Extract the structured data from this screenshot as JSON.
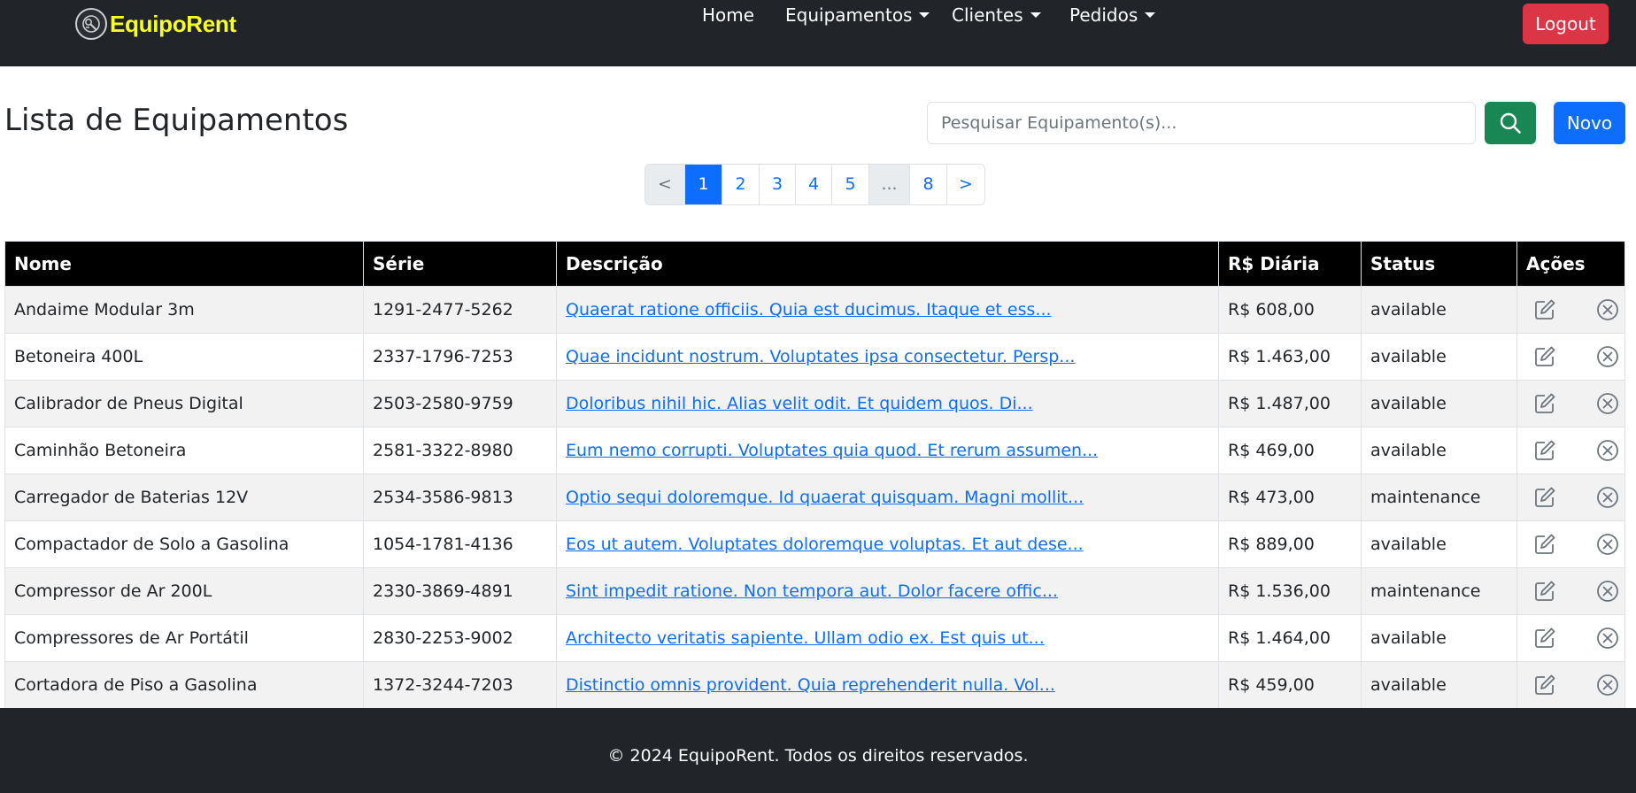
{
  "brand": {
    "name": "EquipoRent"
  },
  "nav": {
    "items": [
      {
        "label": "Home",
        "dropdown": false
      },
      {
        "label": "Equipamentos",
        "dropdown": true
      },
      {
        "label": "Clientes",
        "dropdown": true
      },
      {
        "label": "Pedidos",
        "dropdown": true
      }
    ],
    "logout_label": "Logout"
  },
  "page": {
    "title": "Lista de Equipamentos",
    "search_placeholder": "Pesquisar Equipamento(s)...",
    "search_icon": "search-icon",
    "new_label": "Novo"
  },
  "pagination": {
    "items": [
      "<",
      "1",
      "2",
      "3",
      "4",
      "5",
      "...",
      "8",
      ">"
    ],
    "active": "1"
  },
  "table": {
    "headers": [
      "Nome",
      "Série",
      "Descrição",
      "R$ Diária",
      "Status",
      "Ações"
    ],
    "rows": [
      {
        "nome": "Andaime Modular 3m",
        "serie": "1291-2477-5262",
        "descricao": "Quaerat ratione officiis. Quia est ducimus. Itaque et ess...",
        "diaria": "R$ 608,00",
        "status": "available"
      },
      {
        "nome": "Betoneira 400L",
        "serie": "2337-1796-7253",
        "descricao": "Quae incidunt nostrum. Voluptates ipsa consectetur. Persp...",
        "diaria": "R$ 1.463,00",
        "status": "available"
      },
      {
        "nome": "Calibrador de Pneus Digital",
        "serie": "2503-2580-9759",
        "descricao": "Doloribus nihil hic. Alias velit odit. Et quidem quos. Di...",
        "diaria": "R$ 1.487,00",
        "status": "available"
      },
      {
        "nome": "Caminhão Betoneira",
        "serie": "2581-3322-8980",
        "descricao": "Eum nemo corrupti. Voluptates quia quod. Et rerum assumen...",
        "diaria": "R$ 469,00",
        "status": "available"
      },
      {
        "nome": "Carregador de Baterias 12V",
        "serie": "2534-3586-9813",
        "descricao": "Optio sequi doloremque. Id quaerat quisquam. Magni mollit...",
        "diaria": "R$ 473,00",
        "status": "maintenance"
      },
      {
        "nome": "Compactador de Solo a Gasolina",
        "serie": "1054-1781-4136",
        "descricao": "Eos ut autem. Voluptates doloremque voluptas. Et aut dese...",
        "diaria": "R$ 889,00",
        "status": "available"
      },
      {
        "nome": "Compressor de Ar 200L",
        "serie": "2330-3869-4891",
        "descricao": "Sint impedit ratione. Non tempora aut. Dolor facere offic...",
        "diaria": "R$ 1.536,00",
        "status": "maintenance"
      },
      {
        "nome": "Compressores de Ar Portátil",
        "serie": "2830-2253-9002",
        "descricao": "Architecto veritatis sapiente. Ullam odio ex. Est quis ut...",
        "diaria": "R$ 1.464,00",
        "status": "available"
      },
      {
        "nome": "Cortadora de Piso a Gasolina",
        "serie": "1372-3244-7203",
        "descricao": "Distinctio omnis provident. Quia reprehenderit nulla. Vol...",
        "diaria": "R$ 459,00",
        "status": "available"
      }
    ],
    "row_action_icons": [
      "edit-icon",
      "delete-icon"
    ]
  },
  "footer": {
    "text": "© 2024 EquipoRent. Todos os direitos reservados."
  },
  "colors": {
    "navbar_bg": "#212529",
    "brand_text": "#f6ff1f",
    "logout": "#dc3545",
    "search_button": "#198754",
    "primary": "#0d6efd",
    "table_header_bg": "#000000",
    "row_stripe": "#f2f2f2"
  }
}
